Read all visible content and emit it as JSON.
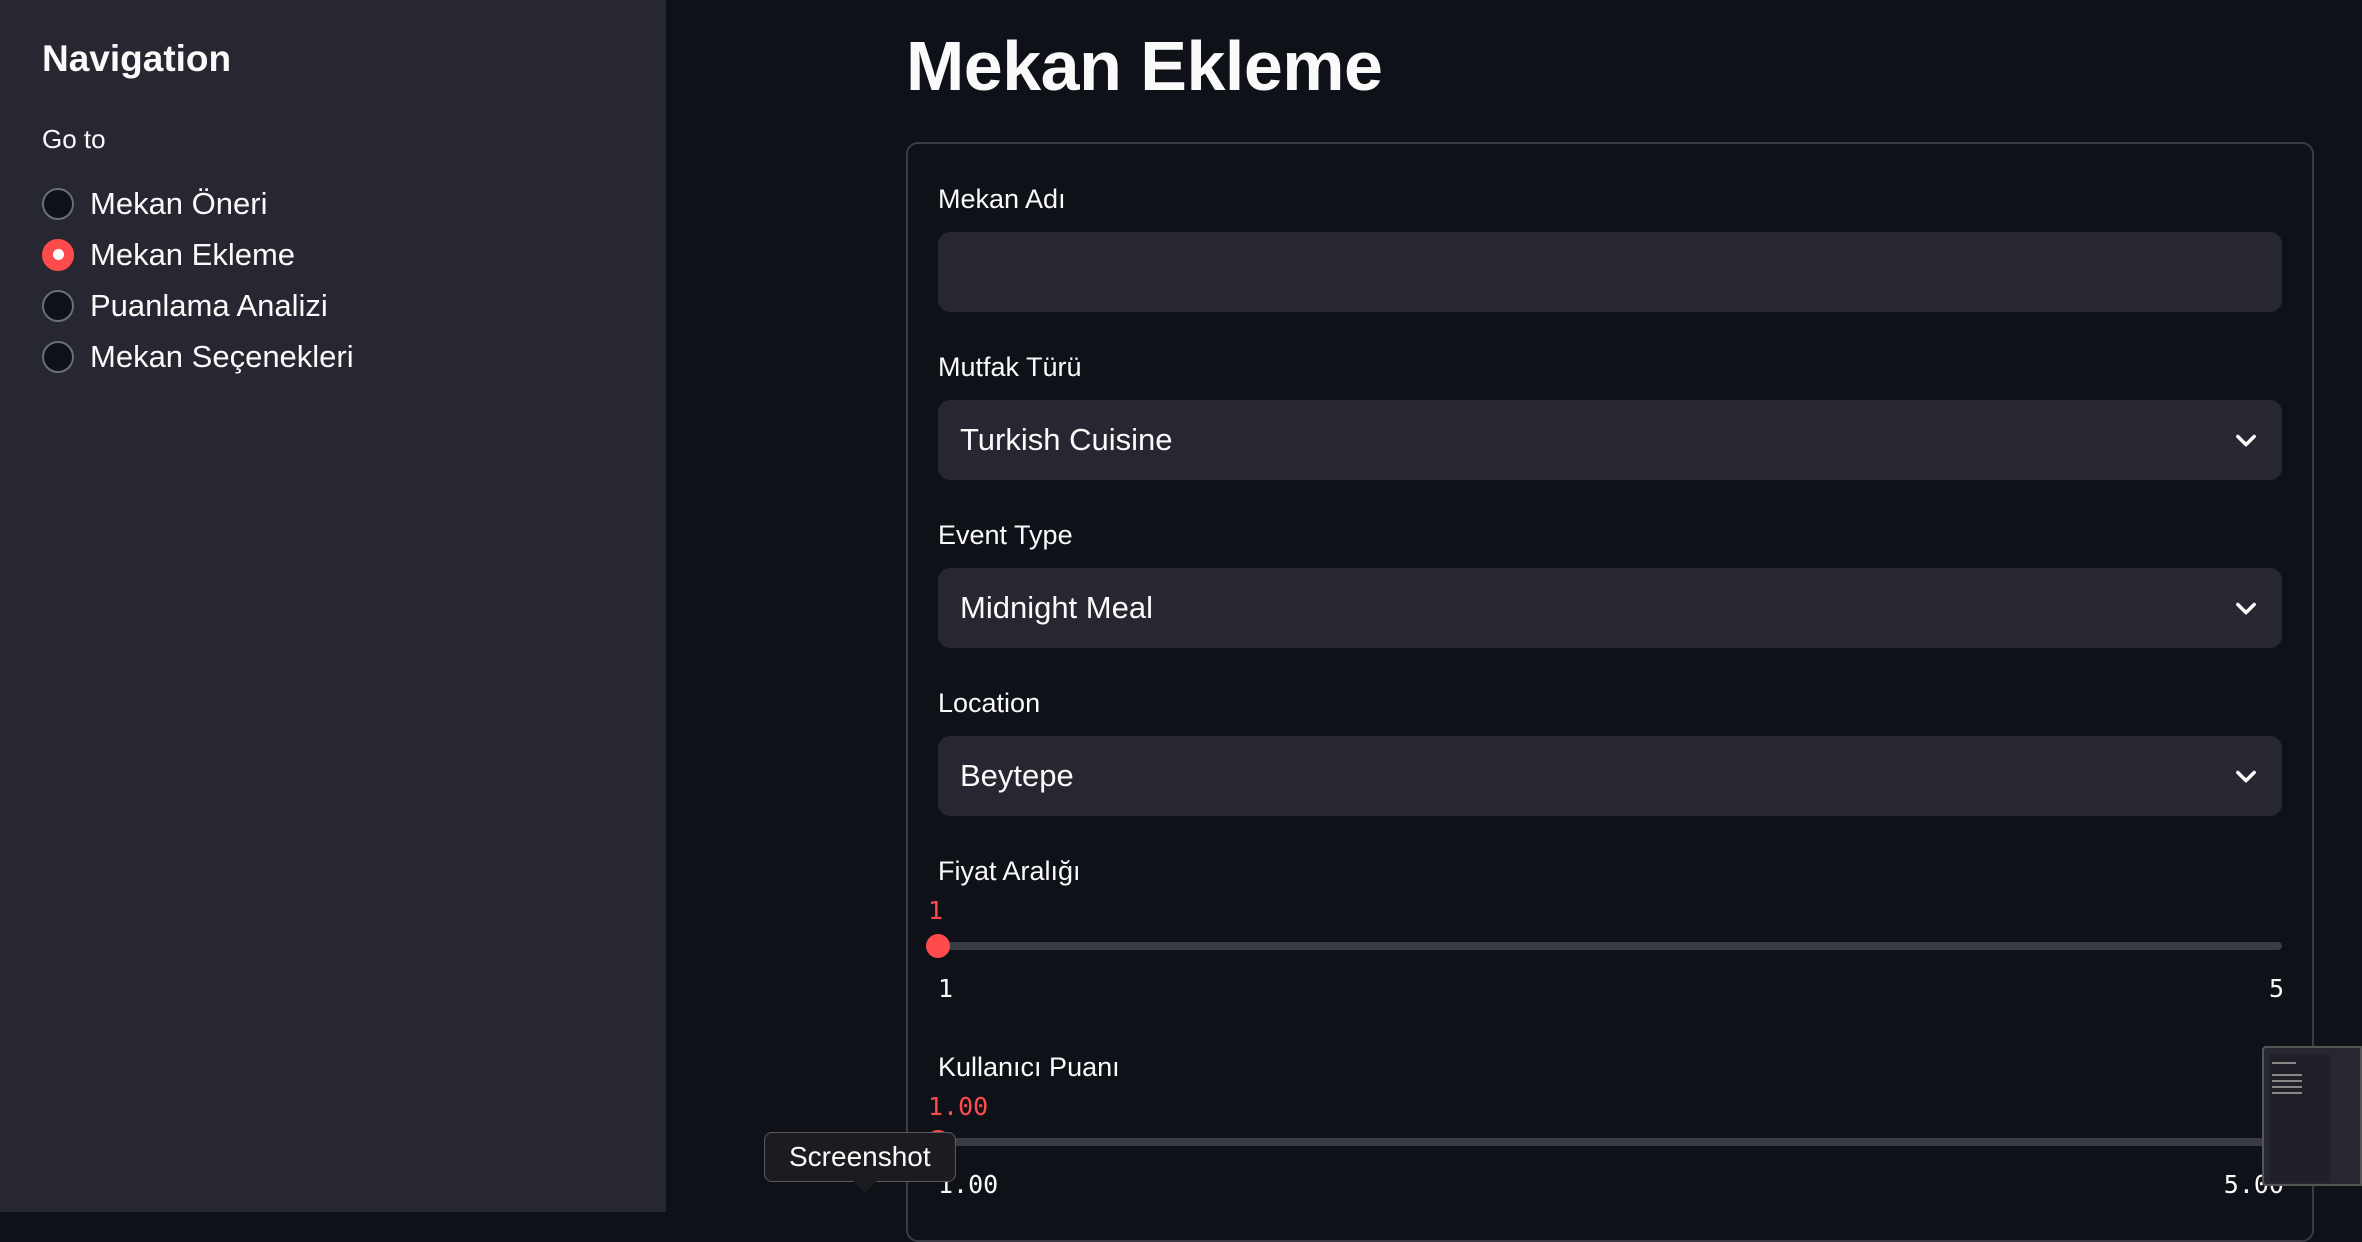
{
  "sidebar": {
    "title": "Navigation",
    "goto_label": "Go to",
    "items": [
      {
        "label": "Mekan Öneri",
        "selected": false
      },
      {
        "label": "Mekan Ekleme",
        "selected": true
      },
      {
        "label": "Puanlama Analizi",
        "selected": false
      },
      {
        "label": "Mekan Seçenekleri",
        "selected": false
      }
    ]
  },
  "main": {
    "title": "Mekan Ekleme",
    "form": {
      "name_label": "Mekan Adı",
      "name_value": "",
      "cuisine_label": "Mutfak Türü",
      "cuisine_value": "Turkish Cuisine",
      "event_label": "Event Type",
      "event_value": "Midnight Meal",
      "location_label": "Location",
      "location_value": "Beytepe",
      "price_label": "Fiyat Aralığı",
      "price_value": "1",
      "price_min": "1",
      "price_max": "5",
      "price_fraction": 0.0,
      "rating_label": "Kullanıcı Puanı",
      "rating_value": "1.00",
      "rating_min": "1.00",
      "rating_max": "5.00",
      "rating_fraction": 0.0
    }
  },
  "tooltip": {
    "text": "Screenshot"
  },
  "colors": {
    "accent": "#ff4b4b",
    "background": "#0e1117",
    "sidebar": "#262730"
  }
}
